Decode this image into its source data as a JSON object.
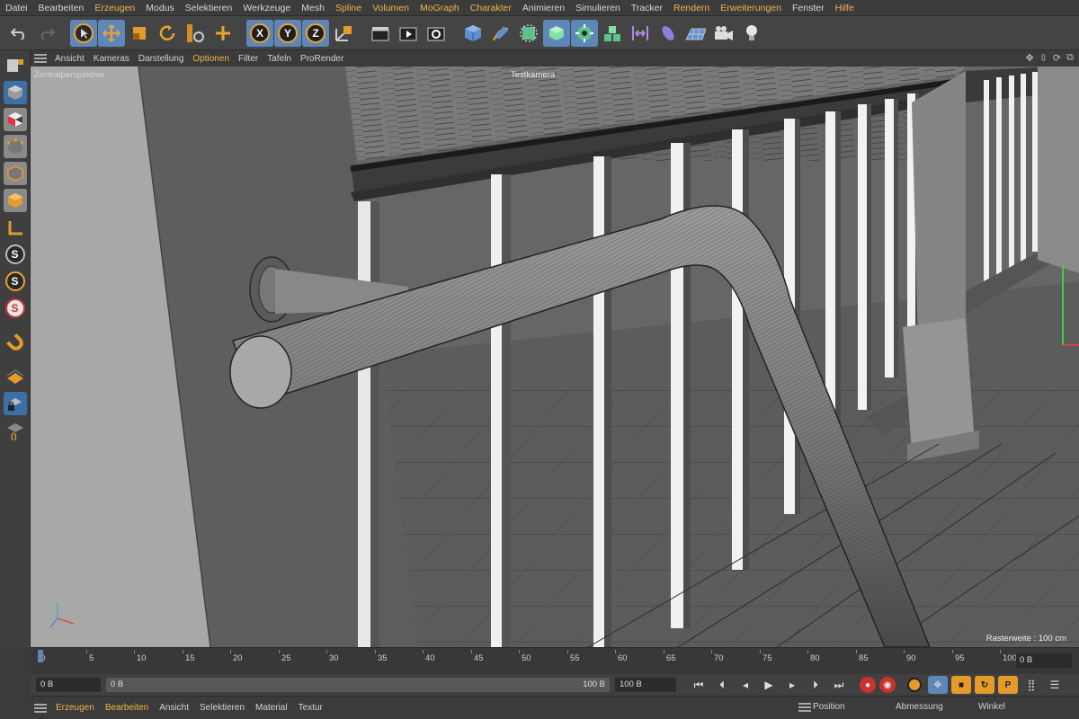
{
  "menubar": {
    "items": [
      "Datei",
      "Bearbeiten",
      "Erzeugen",
      "Modus",
      "Selektieren",
      "Werkzeuge",
      "Mesh",
      "Spline",
      "Volumen",
      "MoGraph",
      "Charakter",
      "Animieren",
      "Simulieren",
      "Tracker",
      "Rendern",
      "Erweiterungen",
      "Fenster",
      "Hilfe"
    ]
  },
  "toolbar": {
    "axis_x": "X",
    "axis_y": "Y",
    "axis_z": "Z"
  },
  "leftbar": {
    "s_letter": "S"
  },
  "viewport": {
    "menu": [
      "Ansicht",
      "Kameras",
      "Darstellung",
      "Optionen",
      "Filter",
      "Tafeln",
      "ProRender"
    ],
    "perspective_label": "Zentralperspektive",
    "camera_label": "Testkamera",
    "grid_label": "Rasterweite : 100 cm"
  },
  "timeline": {
    "ticks": [
      "0",
      "5",
      "10",
      "15",
      "20",
      "25",
      "30",
      "35",
      "40",
      "45",
      "50",
      "55",
      "60",
      "65",
      "70",
      "75",
      "80",
      "85",
      "90",
      "95",
      "100"
    ],
    "current_frame": "0 B"
  },
  "transport": {
    "start_field": "0 B",
    "range_start": "0 B",
    "range_end": "100 B",
    "end_field": "100 B"
  },
  "bottom": {
    "menu": [
      "Erzeugen",
      "Bearbeiten",
      "Ansicht",
      "Selektieren",
      "Material",
      "Textur"
    ],
    "coord_heads": [
      "Position",
      "Abmessung",
      "Winkel"
    ]
  }
}
